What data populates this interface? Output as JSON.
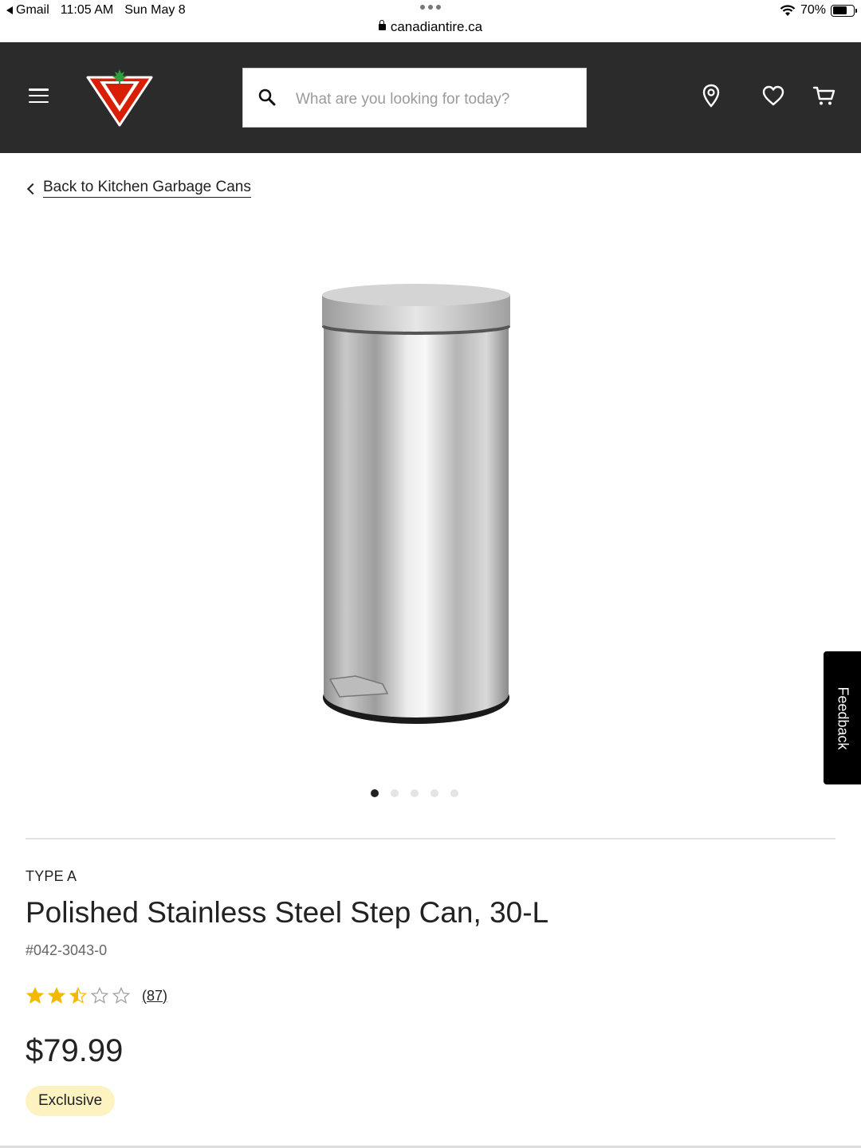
{
  "status_bar": {
    "back_app": "Gmail",
    "time": "11:05 AM",
    "date": "Sun May 8",
    "battery": "70%",
    "url": "canadiantire.ca"
  },
  "header": {
    "search_placeholder": "What are you looking for today?"
  },
  "breadcrumb": {
    "back_label": "Back to Kitchen Garbage Cans"
  },
  "carousel": {
    "total": 5,
    "active_index": 0
  },
  "feedback_label": "Feedback",
  "product": {
    "brand": "TYPE A",
    "title": "Polished Stainless Steel Step Can, 30-L",
    "sku": "#042-3043-0",
    "rating": 2.5,
    "rating_max": 5,
    "review_count": "(87)",
    "price": "$79.99",
    "badge": "Exclusive"
  },
  "colors": {
    "header_bg": "#2b2b2b",
    "logo_red": "#d81e05",
    "star": "#f5b800",
    "badge_bg": "#fdf3c0"
  }
}
